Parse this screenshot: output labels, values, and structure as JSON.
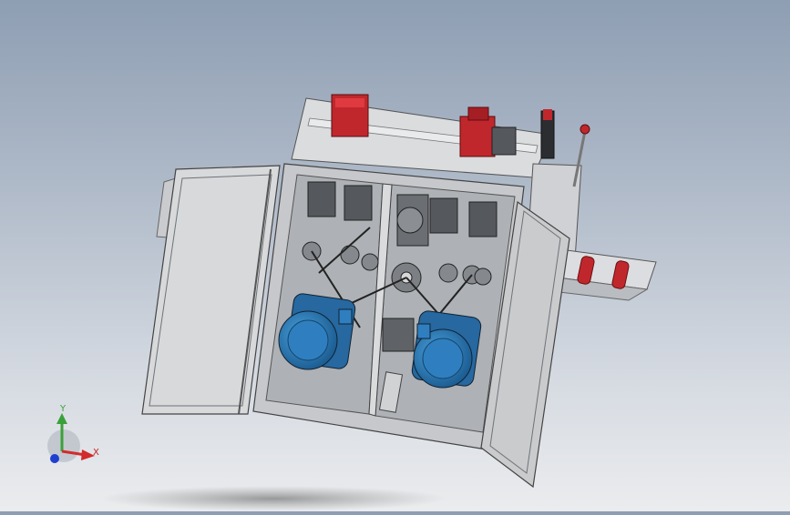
{
  "viewport": {
    "background_top": "#8e9eb3",
    "background_bottom": "#ebecee"
  },
  "colors": {
    "frame": "#d0d2d5",
    "door": "#d7d9db",
    "motor": "#2f7fc0",
    "red_component": "#c0272d",
    "dark_part": "#3a3c40"
  },
  "triad": {
    "x_label": "X",
    "y_label": "Y",
    "x_color": "#d22b2b",
    "y_color": "#3aa13a",
    "z_color": "#1f3fcf"
  }
}
